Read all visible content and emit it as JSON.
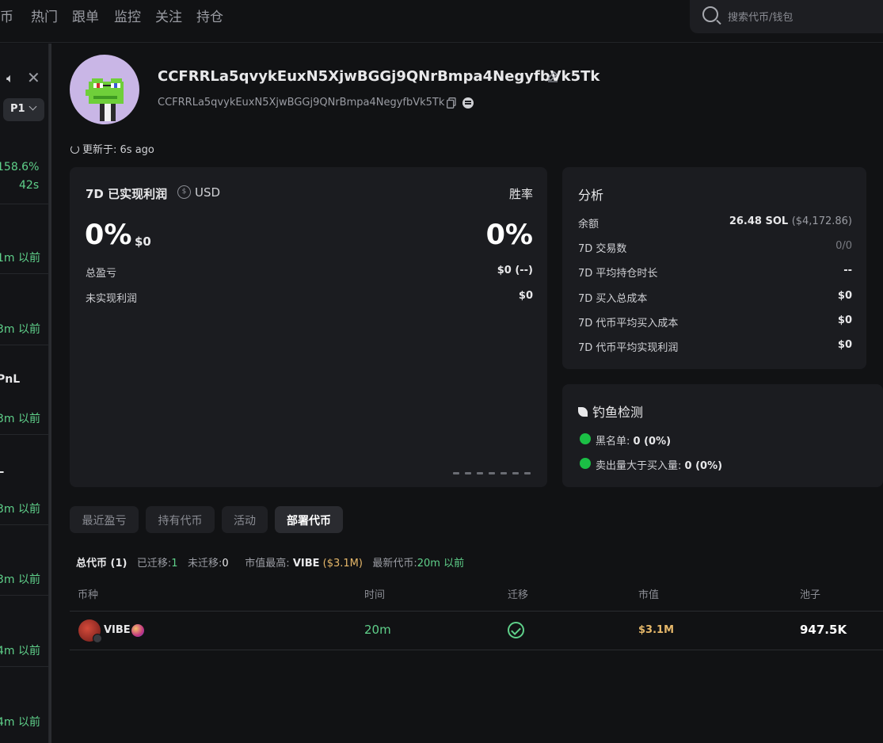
{
  "nav": {
    "items": [
      "币",
      "热门",
      "跟单",
      "监控",
      "关注",
      "持仓"
    ],
    "search_placeholder": "搜索代币/钱包"
  },
  "sidebar": {
    "page_label": "P1",
    "entries": [
      "158.6%",
      "42s",
      "1m 以前",
      "3m 以前",
      "PnL",
      "3m 以前",
      "L",
      "3m 以前",
      "3m 以前",
      "4m 以前",
      "4m 以前"
    ]
  },
  "profile": {
    "name": "CCFRRLa5qvykEuxN5XjwBGGj9QNrBmpa4NegyfbVk5Tk",
    "address": "CCFRRLa5qvykEuxN5XjwBGGj9QNrBmpa4NegyfbVk5Tk",
    "updated": "更新于: 6s ago"
  },
  "pnl": {
    "title": "7D 已实现利润",
    "currency": "USD",
    "winrate_label": "胜率",
    "realized_pct": "0%",
    "realized_usd": "$0",
    "winrate_value": "0%",
    "rows": [
      {
        "label": "总盈亏",
        "value": "$0 (--)"
      },
      {
        "label": "未实现利润",
        "value": "$0"
      }
    ]
  },
  "analysis": {
    "title": "分析",
    "balance_label": "余额",
    "balance_sol": "26.48 SOL",
    "balance_usd": "($4,172.86)",
    "rows": [
      {
        "label": "7D 交易数",
        "value": "0/0"
      },
      {
        "label": "7D 平均持仓时长",
        "value": "--"
      },
      {
        "label": "7D 买入总成本",
        "value": "$0"
      },
      {
        "label": "7D 代币平均买入成本",
        "value": "$0"
      },
      {
        "label": "7D 代币平均实现利润",
        "value": "$0"
      }
    ]
  },
  "phishing": {
    "title": "钓鱼检测",
    "blacklist_label": "黑名单:",
    "blacklist_value": "0 (0%)",
    "sell_gt_buy_label": "卖出量大于买入量:",
    "sell_gt_buy_value": "0 (0%)"
  },
  "tabs": [
    "最近盈亏",
    "持有代币",
    "活动",
    "部署代币"
  ],
  "active_tab": "部署代币",
  "summary": {
    "total": "总代币 (1)",
    "migrated_label": "已迁移:",
    "migrated_value": "1",
    "unmigrated_label": "未迁移:",
    "unmigrated_value": "0",
    "top_mcap_label": "市值最高:",
    "top_mcap_token": "VIBE",
    "top_mcap_value": "($3.1M)",
    "latest_label": "最新代币:",
    "latest_value": "20m 以前"
  },
  "table": {
    "headers": [
      "币种",
      "时间",
      "迁移",
      "市值",
      "池子"
    ],
    "rows": [
      {
        "token": "VIBE",
        "time": "20m",
        "migrated": true,
        "mcap": "$3.1M",
        "pool": "947.5K"
      }
    ]
  },
  "colors": {
    "accent_green": "#5fd08a",
    "status_green": "#1bbf45",
    "gold": "#e6b86a",
    "background": "#111214",
    "card": "#1b1c20"
  }
}
